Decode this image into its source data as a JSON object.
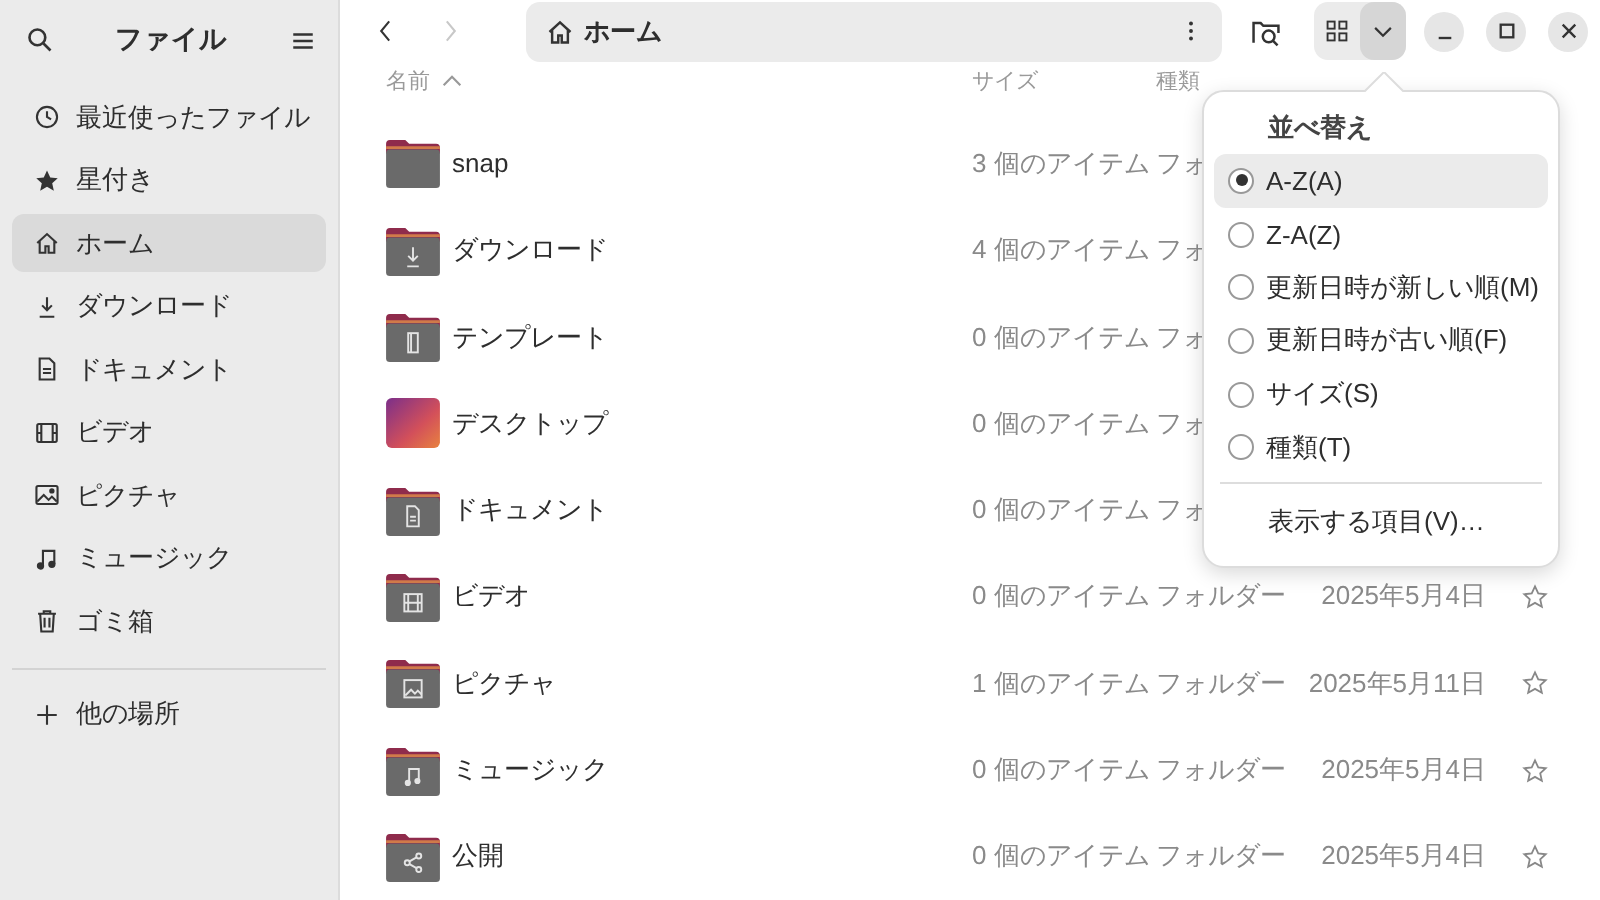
{
  "sidebar": {
    "title": "ファイル",
    "items": [
      {
        "label": "最近使ったファイル",
        "selected": false
      },
      {
        "label": "星付き",
        "selected": false
      },
      {
        "label": "ホーム",
        "selected": true
      },
      {
        "label": "ダウンロード",
        "selected": false
      },
      {
        "label": "ドキュメント",
        "selected": false
      },
      {
        "label": "ビデオ",
        "selected": false
      },
      {
        "label": "ピクチャ",
        "selected": false
      },
      {
        "label": "ミュージック",
        "selected": false
      },
      {
        "label": "ゴミ箱",
        "selected": false
      }
    ],
    "other": {
      "label": "他の場所"
    }
  },
  "toolbar": {
    "back_disabled": false,
    "forward_disabled": true,
    "path": "ホーム"
  },
  "columns": [
    "名前",
    "サイズ",
    "種類"
  ],
  "rows": [
    {
      "name": "snap",
      "size": "3 個のアイテム",
      "type": "フォ"
    },
    {
      "name": "ダウンロード",
      "size": "4 個のアイテム",
      "type": "フォ"
    },
    {
      "name": "テンプレート",
      "size": "0 個のアイテム",
      "type": "フォ"
    },
    {
      "name": "デスクトップ",
      "size": "0 個のアイテム",
      "type": "フォ"
    },
    {
      "name": "ドキュメント",
      "size": "0 個のアイテム",
      "type": "フォ"
    },
    {
      "name": "ビデオ",
      "size": "0 個のアイテム",
      "type": "フォルダー",
      "modified": "2025年5月4日",
      "starred": false
    },
    {
      "name": "ピクチャ",
      "size": "1 個のアイテム",
      "type": "フォルダー",
      "modified": "2025年5月11日",
      "starred": false
    },
    {
      "name": "ミュージック",
      "size": "0 個のアイテム",
      "type": "フォルダー",
      "modified": "2025年5月4日",
      "starred": false
    },
    {
      "name": "公開",
      "size": "0 個のアイテム",
      "type": "フォルダー",
      "modified": "2025年5月4日",
      "starred": false
    }
  ],
  "sort_menu": {
    "title": "並べ替え",
    "options": [
      {
        "label": "A-Z(A)",
        "selected": true,
        "highlighted": true
      },
      {
        "label": "Z-A(Z)",
        "selected": false,
        "highlighted": false
      },
      {
        "label": "更新日時が新しい順(M)",
        "selected": false,
        "highlighted": false
      },
      {
        "label": "更新日時が古い順(F)",
        "selected": false,
        "highlighted": false
      },
      {
        "label": "サイズ(S)",
        "selected": false,
        "highlighted": false
      },
      {
        "label": "種類(T)",
        "selected": false,
        "highlighted": false
      }
    ],
    "footer": "表示する項目(V)…"
  }
}
